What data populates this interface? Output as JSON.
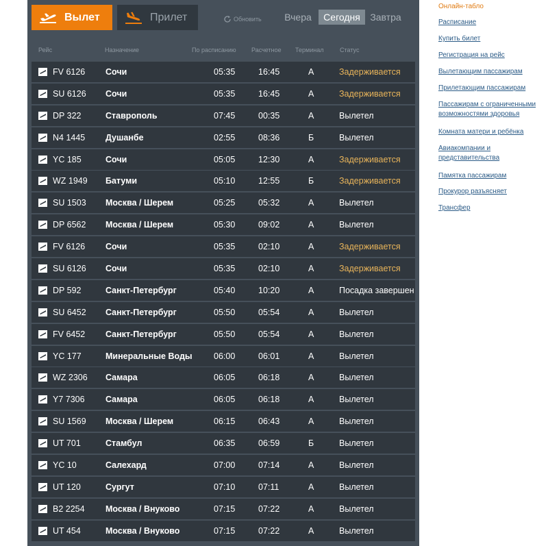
{
  "tabs": {
    "departure": "Вылет",
    "arrival": "Прилет"
  },
  "refresh_label": "Обновить",
  "days": {
    "yesterday": "Вчера",
    "today": "Сегодня",
    "tomorrow": "Завтра"
  },
  "columns": {
    "flight": "Рейс",
    "destination": "Назначение",
    "scheduled": "По расписанию",
    "estimated": "Расчетное",
    "terminal": "Терминал",
    "status": "Статус"
  },
  "flights": [
    {
      "flight": "FV 6126",
      "destination": "Сочи",
      "scheduled": "05:35",
      "estimated": "16:45",
      "terminal": "А",
      "status": "Задерживается",
      "delayed": true
    },
    {
      "flight": "SU 6126",
      "destination": "Сочи",
      "scheduled": "05:35",
      "estimated": "16:45",
      "terminal": "А",
      "status": "Задерживается",
      "delayed": true
    },
    {
      "flight": "DP 322",
      "destination": "Ставрополь",
      "scheduled": "07:45",
      "estimated": "00:35",
      "terminal": "А",
      "status": "Вылетел",
      "delayed": false
    },
    {
      "flight": "N4 1445",
      "destination": "Душанбе",
      "scheduled": "02:55",
      "estimated": "08:36",
      "terminal": "Б",
      "status": "Вылетел",
      "delayed": false
    },
    {
      "flight": "YC 185",
      "destination": "Сочи",
      "scheduled": "05:05",
      "estimated": "12:30",
      "terminal": "А",
      "status": "Задерживается",
      "delayed": true
    },
    {
      "flight": "WZ 1949",
      "destination": "Батуми",
      "scheduled": "05:10",
      "estimated": "12:55",
      "terminal": "Б",
      "status": "Задерживается",
      "delayed": true
    },
    {
      "flight": "SU 1503",
      "destination": "Москва / Шерем",
      "scheduled": "05:25",
      "estimated": "05:32",
      "terminal": "А",
      "status": "Вылетел",
      "delayed": false
    },
    {
      "flight": "DP 6562",
      "destination": "Москва / Шерем",
      "scheduled": "05:30",
      "estimated": "09:02",
      "terminal": "А",
      "status": "Вылетел",
      "delayed": false
    },
    {
      "flight": "FV 6126",
      "destination": "Сочи",
      "scheduled": "05:35",
      "estimated": "02:10",
      "terminal": "А",
      "status": "Задерживается",
      "delayed": true
    },
    {
      "flight": "SU 6126",
      "destination": "Сочи",
      "scheduled": "05:35",
      "estimated": "02:10",
      "terminal": "А",
      "status": "Задерживается",
      "delayed": true
    },
    {
      "flight": "DP 592",
      "destination": "Санкт-Петербург",
      "scheduled": "05:40",
      "estimated": "10:20",
      "terminal": "А",
      "status": "Посадка завершен",
      "delayed": false
    },
    {
      "flight": "SU 6452",
      "destination": "Санкт-Петербург",
      "scheduled": "05:50",
      "estimated": "05:54",
      "terminal": "А",
      "status": "Вылетел",
      "delayed": false
    },
    {
      "flight": "FV 6452",
      "destination": "Санкт-Петербург",
      "scheduled": "05:50",
      "estimated": "05:54",
      "terminal": "А",
      "status": "Вылетел",
      "delayed": false
    },
    {
      "flight": "YC 177",
      "destination": "Минеральные Воды",
      "scheduled": "06:00",
      "estimated": "06:01",
      "terminal": "А",
      "status": "Вылетел",
      "delayed": false
    },
    {
      "flight": "WZ 2306",
      "destination": "Самара",
      "scheduled": "06:05",
      "estimated": "06:18",
      "terminal": "А",
      "status": "Вылетел",
      "delayed": false
    },
    {
      "flight": "Y7 7306",
      "destination": "Самара",
      "scheduled": "06:05",
      "estimated": "06:18",
      "terminal": "А",
      "status": "Вылетел",
      "delayed": false
    },
    {
      "flight": "SU 1569",
      "destination": "Москва / Шерем",
      "scheduled": "06:15",
      "estimated": "06:43",
      "terminal": "А",
      "status": "Вылетел",
      "delayed": false
    },
    {
      "flight": "UT 701",
      "destination": "Стамбул",
      "scheduled": "06:35",
      "estimated": "06:59",
      "terminal": "Б",
      "status": "Вылетел",
      "delayed": false
    },
    {
      "flight": "YC 10",
      "destination": "Салехард",
      "scheduled": "07:00",
      "estimated": "07:14",
      "terminal": "А",
      "status": "Вылетел",
      "delayed": false
    },
    {
      "flight": "UT 120",
      "destination": "Сургут",
      "scheduled": "07:10",
      "estimated": "07:11",
      "terminal": "А",
      "status": "Вылетел",
      "delayed": false
    },
    {
      "flight": "B2 2254",
      "destination": "Москва / Внуково",
      "scheduled": "07:15",
      "estimated": "07:22",
      "terminal": "А",
      "status": "Вылетел",
      "delayed": false
    },
    {
      "flight": "UT 454",
      "destination": "Москва / Внуково",
      "scheduled": "07:15",
      "estimated": "07:22",
      "terminal": "А",
      "status": "Вылетел",
      "delayed": false
    }
  ],
  "sidebar": {
    "items": [
      {
        "label": "Онлайн-табло",
        "active": true
      },
      {
        "label": "Расписание",
        "active": false
      },
      {
        "label": "Купить билет",
        "active": false
      },
      {
        "label": "Регистрация на рейс",
        "active": false
      },
      {
        "label": "Вылетающим пассажирам",
        "active": false
      },
      {
        "label": "Прилетающим пассажирам",
        "active": false
      },
      {
        "label": "Пассажирам с ограниченными возможностями здоровья",
        "active": false
      },
      {
        "label": "Комната матери и ребёнка",
        "active": false
      },
      {
        "label": "Авиакомпании и представительства",
        "active": false
      },
      {
        "label": "Памятка пассажирам",
        "active": false
      },
      {
        "label": "Прокурор разъясняет",
        "active": false
      },
      {
        "label": "Трансфер",
        "active": false
      }
    ]
  },
  "colors": {
    "accent": "#ee7e0d",
    "board_bg": "#46505a",
    "row_bg": "#30373e",
    "delayed": "#e8b45a",
    "link": "#2a5a86"
  }
}
